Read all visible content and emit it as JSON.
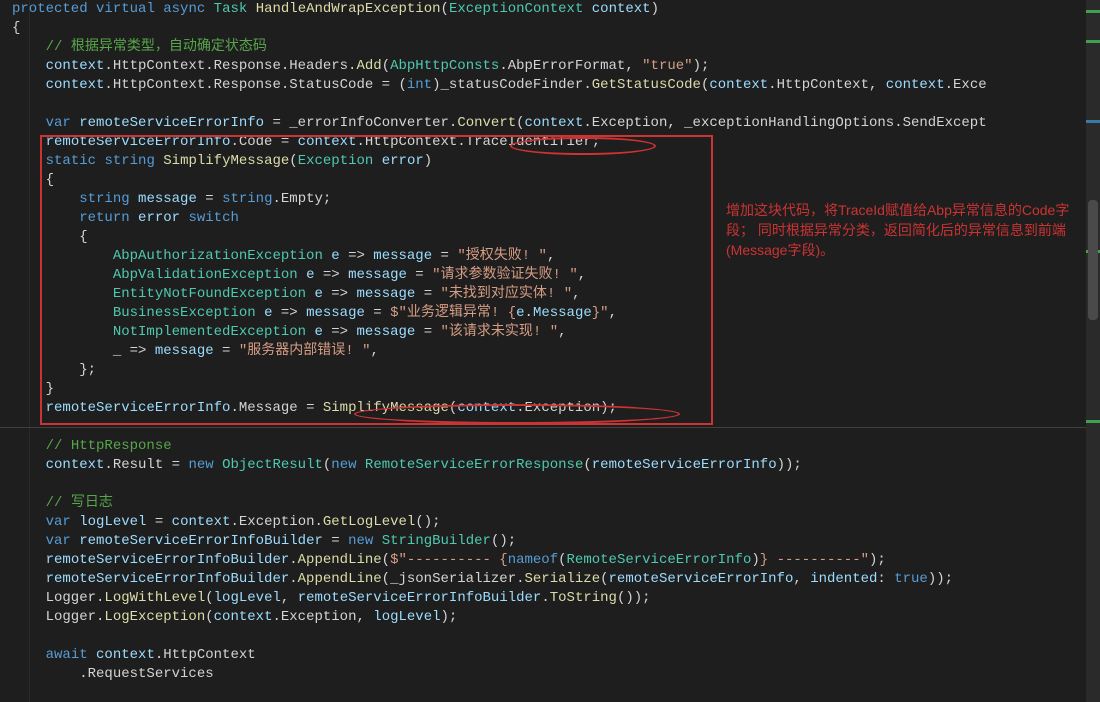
{
  "code": {
    "lines": [
      [
        [
          "kw",
          "protected"
        ],
        [
          "pl",
          " "
        ],
        [
          "kw",
          "virtual"
        ],
        [
          "pl",
          " "
        ],
        [
          "kw",
          "async"
        ],
        [
          "pl",
          " "
        ],
        [
          "type",
          "Task"
        ],
        [
          "pl",
          " "
        ],
        [
          "method",
          "HandleAndWrapException"
        ],
        [
          "pl",
          "("
        ],
        [
          "type",
          "ExceptionContext"
        ],
        [
          "pl",
          " "
        ],
        [
          "param",
          "context"
        ],
        [
          "pl",
          ")"
        ]
      ],
      [
        [
          "pl",
          "{"
        ]
      ],
      [
        [
          "pl",
          "    "
        ],
        [
          "comment",
          "// 根据异常类型，自动确定状态码"
        ]
      ],
      [
        [
          "pl",
          "    "
        ],
        [
          "param",
          "context"
        ],
        [
          "pl",
          ".HttpContext.Response.Headers."
        ],
        [
          "method",
          "Add"
        ],
        [
          "pl",
          "("
        ],
        [
          "type",
          "AbpHttpConsts"
        ],
        [
          "pl",
          ".AbpErrorFormat, "
        ],
        [
          "str",
          "\"true\""
        ],
        [
          "pl",
          ");"
        ]
      ],
      [
        [
          "pl",
          "    "
        ],
        [
          "param",
          "context"
        ],
        [
          "pl",
          ".HttpContext.Response.StatusCode = ("
        ],
        [
          "kw",
          "int"
        ],
        [
          "pl",
          ")_statusCodeFinder."
        ],
        [
          "method",
          "GetStatusCode"
        ],
        [
          "pl",
          "("
        ],
        [
          "param",
          "context"
        ],
        [
          "pl",
          ".HttpContext, "
        ],
        [
          "param",
          "context"
        ],
        [
          "pl",
          ".Exce"
        ]
      ],
      [
        [
          "pl",
          " "
        ]
      ],
      [
        [
          "pl",
          "    "
        ],
        [
          "kw",
          "var"
        ],
        [
          "pl",
          " "
        ],
        [
          "param",
          "remoteServiceErrorInfo"
        ],
        [
          "pl",
          " = _errorInfoConverter."
        ],
        [
          "method",
          "Convert"
        ],
        [
          "pl",
          "("
        ],
        [
          "param",
          "context"
        ],
        [
          "pl",
          ".Exception, _exceptionHandlingOptions.SendExcept"
        ]
      ],
      [
        [
          "pl",
          "    "
        ],
        [
          "param",
          "remoteServiceErrorInfo"
        ],
        [
          "pl",
          ".Code = "
        ],
        [
          "param",
          "context"
        ],
        [
          "pl",
          ".HttpContext.TraceIdentifier;"
        ]
      ],
      [
        [
          "pl",
          "    "
        ],
        [
          "kw",
          "static"
        ],
        [
          "pl",
          " "
        ],
        [
          "kw",
          "string"
        ],
        [
          "pl",
          " "
        ],
        [
          "method",
          "SimplifyMessage"
        ],
        [
          "pl",
          "("
        ],
        [
          "type",
          "Exception"
        ],
        [
          "pl",
          " "
        ],
        [
          "param",
          "error"
        ],
        [
          "pl",
          ")"
        ]
      ],
      [
        [
          "pl",
          "    {"
        ]
      ],
      [
        [
          "pl",
          "        "
        ],
        [
          "kw",
          "string"
        ],
        [
          "pl",
          " "
        ],
        [
          "param",
          "message"
        ],
        [
          "pl",
          " = "
        ],
        [
          "kw",
          "string"
        ],
        [
          "pl",
          ".Empty;"
        ]
      ],
      [
        [
          "pl",
          "        "
        ],
        [
          "kw",
          "return"
        ],
        [
          "pl",
          " "
        ],
        [
          "param",
          "error"
        ],
        [
          "pl",
          " "
        ],
        [
          "kw",
          "switch"
        ]
      ],
      [
        [
          "pl",
          "        {"
        ]
      ],
      [
        [
          "pl",
          "            "
        ],
        [
          "type",
          "AbpAuthorizationException"
        ],
        [
          "pl",
          " "
        ],
        [
          "param",
          "e"
        ],
        [
          "pl",
          " => "
        ],
        [
          "param",
          "message"
        ],
        [
          "pl",
          " = "
        ],
        [
          "str",
          "\"授权失败! \""
        ],
        [
          "pl",
          ","
        ]
      ],
      [
        [
          "pl",
          "            "
        ],
        [
          "type",
          "AbpValidationException"
        ],
        [
          "pl",
          " "
        ],
        [
          "param",
          "e"
        ],
        [
          "pl",
          " => "
        ],
        [
          "param",
          "message"
        ],
        [
          "pl",
          " = "
        ],
        [
          "str",
          "\"请求参数验证失败! \""
        ],
        [
          "pl",
          ","
        ]
      ],
      [
        [
          "pl",
          "            "
        ],
        [
          "type",
          "EntityNotFoundException"
        ],
        [
          "pl",
          " "
        ],
        [
          "param",
          "e"
        ],
        [
          "pl",
          " => "
        ],
        [
          "param",
          "message"
        ],
        [
          "pl",
          " = "
        ],
        [
          "str",
          "\"未找到对应实体! \""
        ],
        [
          "pl",
          ","
        ]
      ],
      [
        [
          "pl",
          "            "
        ],
        [
          "type",
          "BusinessException"
        ],
        [
          "pl",
          " "
        ],
        [
          "param",
          "e"
        ],
        [
          "pl",
          " => "
        ],
        [
          "param",
          "message"
        ],
        [
          "pl",
          " = "
        ],
        [
          "str",
          "$\"业务逻辑异常! {"
        ],
        [
          "param",
          "e"
        ],
        [
          "pl",
          "."
        ],
        [
          "param",
          "Message"
        ],
        [
          "str",
          "}\""
        ],
        [
          "pl",
          ","
        ]
      ],
      [
        [
          "pl",
          "            "
        ],
        [
          "type",
          "NotImplementedException"
        ],
        [
          "pl",
          " "
        ],
        [
          "param",
          "e"
        ],
        [
          "pl",
          " => "
        ],
        [
          "param",
          "message"
        ],
        [
          "pl",
          " = "
        ],
        [
          "str",
          "\"该请求未实现! \""
        ],
        [
          "pl",
          ","
        ]
      ],
      [
        [
          "pl",
          "            _ => "
        ],
        [
          "param",
          "message"
        ],
        [
          "pl",
          " = "
        ],
        [
          "str",
          "\"服务器内部错误! \""
        ],
        [
          "pl",
          ","
        ]
      ],
      [
        [
          "pl",
          "        };"
        ]
      ],
      [
        [
          "pl",
          "    }"
        ]
      ],
      [
        [
          "pl",
          "    "
        ],
        [
          "param",
          "remoteServiceErrorInfo"
        ],
        [
          "pl",
          ".Message = "
        ],
        [
          "method",
          "SimplifyMessage"
        ],
        [
          "pl",
          "("
        ],
        [
          "param",
          "context"
        ],
        [
          "pl",
          ".Exception);"
        ]
      ],
      [
        [
          "pl",
          " "
        ]
      ],
      [
        [
          "pl",
          "    "
        ],
        [
          "comment",
          "// HttpResponse"
        ]
      ],
      [
        [
          "pl",
          "    "
        ],
        [
          "param",
          "context"
        ],
        [
          "pl",
          ".Result = "
        ],
        [
          "kw",
          "new"
        ],
        [
          "pl",
          " "
        ],
        [
          "type",
          "ObjectResult"
        ],
        [
          "pl",
          "("
        ],
        [
          "kw",
          "new"
        ],
        [
          "pl",
          " "
        ],
        [
          "type",
          "RemoteServiceErrorResponse"
        ],
        [
          "pl",
          "("
        ],
        [
          "param",
          "remoteServiceErrorInfo"
        ],
        [
          "pl",
          "));"
        ]
      ],
      [
        [
          "pl",
          " "
        ]
      ],
      [
        [
          "pl",
          "    "
        ],
        [
          "comment",
          "// 写日志"
        ]
      ],
      [
        [
          "pl",
          "    "
        ],
        [
          "kw",
          "var"
        ],
        [
          "pl",
          " "
        ],
        [
          "param",
          "logLevel"
        ],
        [
          "pl",
          " = "
        ],
        [
          "param",
          "context"
        ],
        [
          "pl",
          ".Exception."
        ],
        [
          "method",
          "GetLogLevel"
        ],
        [
          "pl",
          "();"
        ]
      ],
      [
        [
          "pl",
          "    "
        ],
        [
          "kw",
          "var"
        ],
        [
          "pl",
          " "
        ],
        [
          "param",
          "remoteServiceErrorInfoBuilder"
        ],
        [
          "pl",
          " = "
        ],
        [
          "kw",
          "new"
        ],
        [
          "pl",
          " "
        ],
        [
          "type",
          "StringBuilder"
        ],
        [
          "pl",
          "();"
        ]
      ],
      [
        [
          "pl",
          "    "
        ],
        [
          "param",
          "remoteServiceErrorInfoBuilder"
        ],
        [
          "pl",
          "."
        ],
        [
          "method",
          "AppendLine"
        ],
        [
          "pl",
          "("
        ],
        [
          "str",
          "$\"---------- {"
        ],
        [
          "kw",
          "nameof"
        ],
        [
          "pl",
          "("
        ],
        [
          "type",
          "RemoteServiceErrorInfo"
        ],
        [
          "pl",
          ")"
        ],
        [
          "str",
          "} ----------\""
        ],
        [
          "pl",
          ");"
        ]
      ],
      [
        [
          "pl",
          "    "
        ],
        [
          "param",
          "remoteServiceErrorInfoBuilder"
        ],
        [
          "pl",
          "."
        ],
        [
          "method",
          "AppendLine"
        ],
        [
          "pl",
          "(_jsonSerializer."
        ],
        [
          "method",
          "Serialize"
        ],
        [
          "pl",
          "("
        ],
        [
          "param",
          "remoteServiceErrorInfo"
        ],
        [
          "pl",
          ", "
        ],
        [
          "param",
          "indented"
        ],
        [
          "pl",
          ": "
        ],
        [
          "kw",
          "true"
        ],
        [
          "pl",
          "));"
        ]
      ],
      [
        [
          "pl",
          "    Logger."
        ],
        [
          "method",
          "LogWithLevel"
        ],
        [
          "pl",
          "("
        ],
        [
          "param",
          "logLevel"
        ],
        [
          "pl",
          ", "
        ],
        [
          "param",
          "remoteServiceErrorInfoBuilder"
        ],
        [
          "pl",
          "."
        ],
        [
          "method",
          "ToString"
        ],
        [
          "pl",
          "());"
        ]
      ],
      [
        [
          "pl",
          "    Logger."
        ],
        [
          "method",
          "LogException"
        ],
        [
          "pl",
          "("
        ],
        [
          "param",
          "context"
        ],
        [
          "pl",
          ".Exception, "
        ],
        [
          "param",
          "logLevel"
        ],
        [
          "pl",
          ");"
        ]
      ],
      [
        [
          "pl",
          " "
        ]
      ],
      [
        [
          "pl",
          "    "
        ],
        [
          "kw",
          "await"
        ],
        [
          "pl",
          " "
        ],
        [
          "param",
          "context"
        ],
        [
          "pl",
          ".HttpContext"
        ]
      ],
      [
        [
          "pl",
          "        .RequestServices"
        ]
      ]
    ]
  },
  "annotation": {
    "text": "增加这块代码，将TraceId赋值给Abp异常信息的Code字段；\n同时根据异常分类，返回简化后的异常信息到前端(Message字段)。"
  }
}
